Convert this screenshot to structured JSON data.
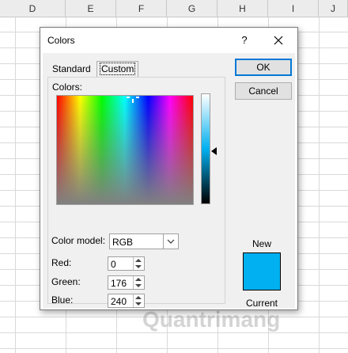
{
  "spreadsheet": {
    "columns": [
      "D",
      "E",
      "F",
      "G",
      "H",
      "I",
      "J"
    ]
  },
  "dialog": {
    "title": "Colors",
    "help_label": "?",
    "tabs": [
      "Standard",
      "Custom"
    ],
    "active_tab": "Custom",
    "colors_label": "Colors:",
    "color_model_label": "Color model:",
    "color_model_value": "RGB",
    "fields": [
      {
        "label": "Red:",
        "value": "0"
      },
      {
        "label": "Green:",
        "value": "176"
      },
      {
        "label": "Blue:",
        "value": "240"
      }
    ],
    "ok_label": "OK",
    "cancel_label": "Cancel",
    "new_label": "New",
    "current_label": "Current",
    "selected_color": "#00b0f0"
  },
  "watermark": "Quantrimang"
}
